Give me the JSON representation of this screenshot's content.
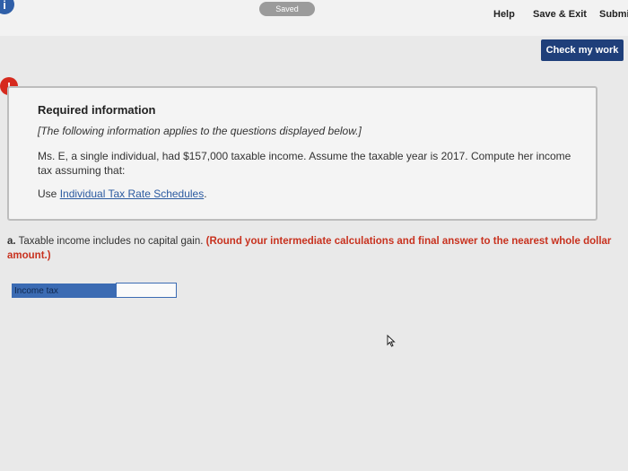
{
  "header": {
    "info_icon": "i",
    "saved_label": "Saved",
    "help_label": "Help",
    "save_exit_label": "Save & Exit",
    "submit_label": "Submi"
  },
  "toolbar": {
    "check_label": "Check my work"
  },
  "alert": {
    "icon_glyph": "!"
  },
  "required": {
    "title": "Required information",
    "italic_note": "[The following information applies to the questions displayed below.]",
    "body": "Ms. E, a single individual, had $157,000 taxable income. Assume the taxable year is 2017. Compute her income tax assuming that:",
    "use_prefix": "Use ",
    "link_text": "Individual Tax Rate Schedules",
    "use_suffix": "."
  },
  "question": {
    "letter": "a.",
    "text": " Taxable income includes no capital gain. ",
    "instruction": "(Round your intermediate calculations and final answer to the nearest whole dollar amount.)"
  },
  "answer": {
    "label": "Income tax",
    "value": ""
  },
  "icons": {
    "cursor": "mouse-pointer-icon"
  }
}
